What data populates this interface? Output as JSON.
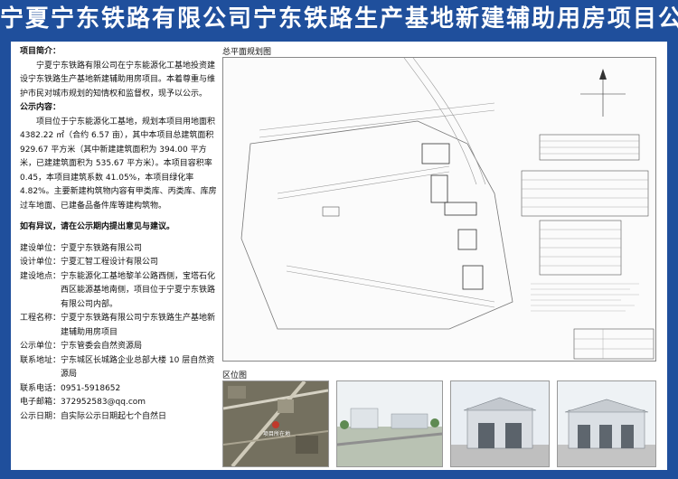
{
  "title": "宁夏宁东铁路有限公司宁东铁路生产基地新建辅助用房项目公示",
  "intro_heading": "项目简介：",
  "intro_text": "宁夏宁东铁路有限公司在宁东能源化工基地投资建设宁东铁路生产基地新建辅助用房项目。本着尊重与维护市民对城市规划的知情权和监督权，现予以公示。",
  "content_heading": "公示内容：",
  "content_text": "项目位于宁东能源化工基地，规划本项目用地面积 4382.22 ㎡（合约 6.57 亩），其中本项目总建筑面积 929.67 平方米（其中新建建筑面积为 394.00 平方米，已建建筑面积为 535.67 平方米）。本项目容积率 0.45，本项目建筑系数 41.05%，本项目绿化率 4.82%。主要新建构筑物内容有甲类库、丙类库、库房过车地面、已建备品备件库等建构筑物。",
  "objection": "如有异议，请在公示期内提出意见与建议。",
  "info": [
    {
      "k": "建设单位：",
      "v": "宁夏宁东铁路有限公司"
    },
    {
      "k": "设计单位：",
      "v": "宁夏汇智工程设计有限公司"
    },
    {
      "k": "建设地点：",
      "v": "宁东能源化工基地黎羊公路西侧，宝塔石化西区能源基地南侧，项目位于宁夏宁东铁路有限公司内部。"
    },
    {
      "k": "工程名称：",
      "v": "宁夏宁东铁路有限公司宁东铁路生产基地新建辅助用房项目"
    },
    {
      "k": "公示单位：",
      "v": "宁东管委会自然资源局"
    },
    {
      "k": "联系地址：",
      "v": "宁东城区长城路企业总部大楼 10 层自然资源局"
    },
    {
      "k": "联系电话：",
      "v": "0951-5918652"
    },
    {
      "k": "电子邮箱：",
      "v": "372952583@qq.com"
    },
    {
      "k": "公示日期：",
      "v": "自实际公示日期起七个自然日"
    }
  ],
  "plan_label": "总平面规划图",
  "location_label": "区位图",
  "map_marker": "项目所在地",
  "colors": {
    "banner": "#1f4f9c",
    "panel": "#ffffff",
    "text": "#111111"
  }
}
